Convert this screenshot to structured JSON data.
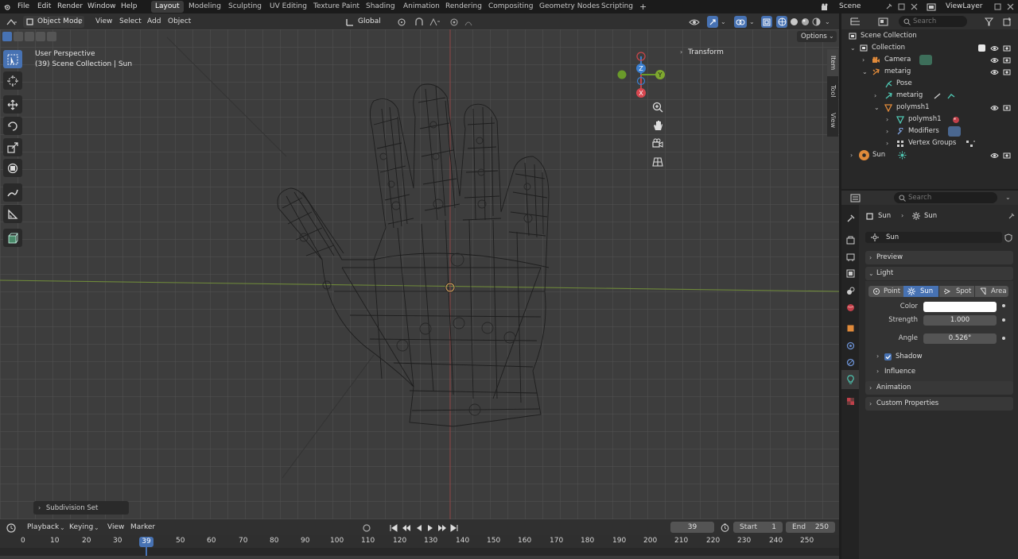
{
  "topbar": {
    "menus": [
      "File",
      "Edit",
      "Render",
      "Window",
      "Help"
    ],
    "workspaces": [
      "Layout",
      "Modeling",
      "Sculpting",
      "UV Editing",
      "Texture Paint",
      "Shading",
      "Animation",
      "Rendering",
      "Compositing",
      "Geometry Nodes",
      "Scripting"
    ],
    "active_workspace": "Layout",
    "add_tab": "+",
    "scene": "Scene",
    "view_layer": "ViewLayer"
  },
  "viewport_header": {
    "mode": "Object Mode",
    "menus": [
      "View",
      "Select",
      "Add",
      "Object"
    ],
    "orientation": "Global",
    "options": "Options"
  },
  "viewport": {
    "perspective": "User Perspective",
    "collection_info": "(39) Scene Collection | Sun",
    "transform_panel": "Transform",
    "side_tabs": [
      "Item",
      "Tool",
      "View"
    ],
    "last_operator": "Subdivision Set",
    "gizmo": {
      "x": "X",
      "y": "Y",
      "z": "Z"
    }
  },
  "timeline": {
    "menus": [
      "Playback",
      "Keying",
      "View",
      "Marker"
    ],
    "current_frame": "39",
    "start_label": "Start",
    "start": "1",
    "end_label": "End",
    "end": "250",
    "ticks": [
      "0",
      "10",
      "20",
      "30",
      "50",
      "60",
      "70",
      "80",
      "90",
      "100",
      "110",
      "120",
      "130",
      "140",
      "150",
      "160",
      "170",
      "180",
      "190",
      "200",
      "210",
      "220",
      "230",
      "240",
      "250"
    ],
    "playhead": "39"
  },
  "outliner": {
    "search_placeholder": "Search",
    "rows": [
      {
        "label": "Scene Collection"
      },
      {
        "label": "Collection"
      },
      {
        "label": "Camera"
      },
      {
        "label": "metarig"
      },
      {
        "label": "Pose"
      },
      {
        "label": "metarig"
      },
      {
        "label": "polymsh1"
      },
      {
        "label": "polymsh1"
      },
      {
        "label": "Modifiers"
      },
      {
        "label": "Vertex Groups"
      },
      {
        "label": "Sun"
      }
    ]
  },
  "properties": {
    "search_placeholder": "Search",
    "breadcrumb": [
      "Sun",
      "Sun"
    ],
    "datablock": "Sun",
    "panels": {
      "preview": "Preview",
      "light": "Light",
      "shadow": "Shadow",
      "influence": "Influence",
      "animation": "Animation",
      "custom": "Custom Properties"
    },
    "light_types": [
      "Point",
      "Sun",
      "Spot",
      "Area"
    ],
    "active_light_type": "Sun",
    "color_label": "Color",
    "strength_label": "Strength",
    "strength": "1.000",
    "angle_label": "Angle",
    "angle": "0.526°",
    "shadow_enabled": true,
    "colors": {
      "accent": "#4772b3",
      "color_swatch": "#ffffff"
    }
  }
}
